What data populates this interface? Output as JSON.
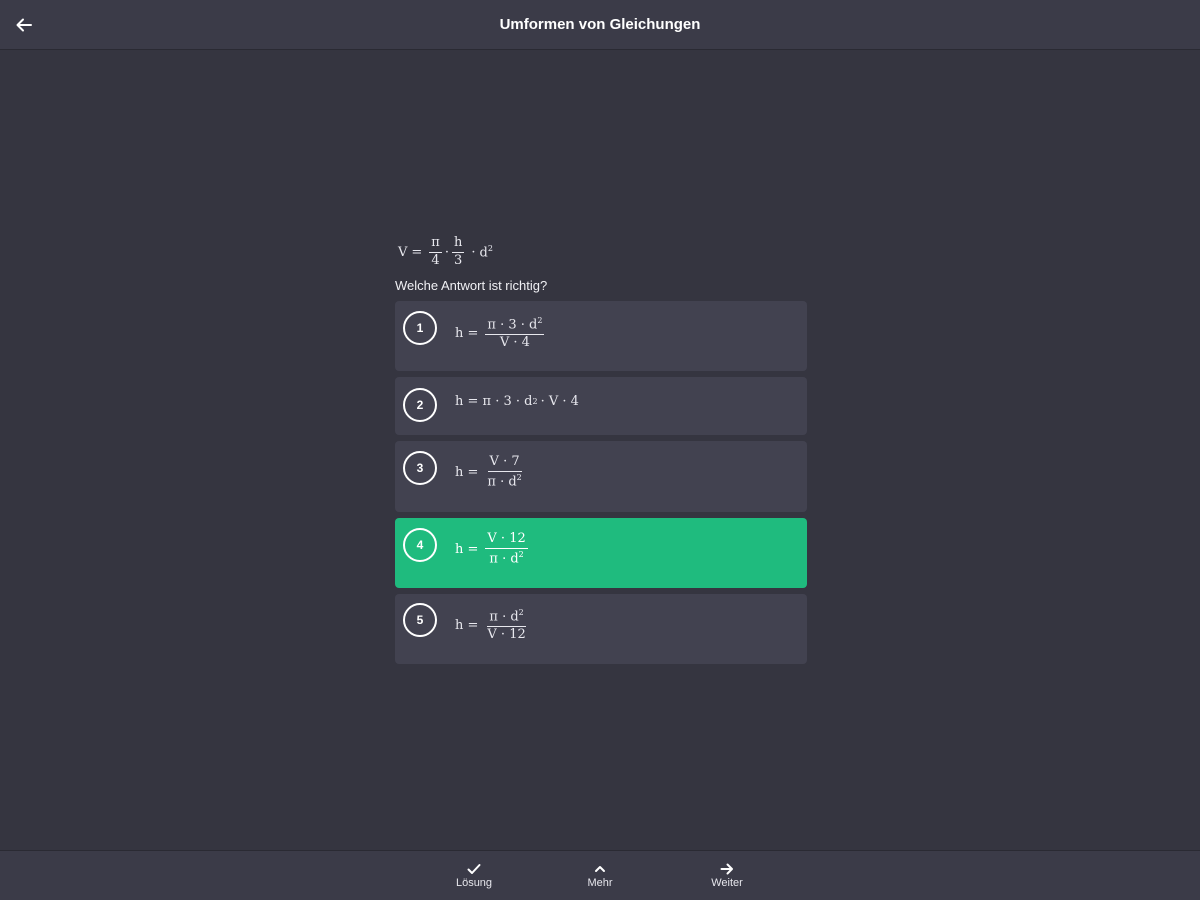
{
  "header": {
    "title": "Umformen von Gleichungen",
    "back_icon": "arrow-left-icon"
  },
  "question": {
    "formula": {
      "lhs": "V",
      "eq": "=",
      "f1_num": "π",
      "f1_den": "4",
      "dot1": "·",
      "f2_num": "h",
      "f2_den": "3",
      "dot2": "·",
      "d": "d",
      "d_exp": "2"
    },
    "prompt": "Welche Antwort ist richtig?"
  },
  "options": [
    {
      "number": "1",
      "lhs": "h =",
      "num": "π · 3 · d",
      "num_exp": "2",
      "den": "V · 4",
      "selected": false
    },
    {
      "number": "2",
      "text": "h = π · 3 · d",
      "exp": "2",
      "text_after": "· V · 4",
      "selected": false
    },
    {
      "number": "3",
      "lhs": "h =",
      "num": "V · 7",
      "den": "π · d",
      "den_exp": "2",
      "selected": false
    },
    {
      "number": "4",
      "lhs": "h =",
      "num": "V · 12",
      "den": "π · d",
      "den_exp": "2",
      "selected": true
    },
    {
      "number": "5",
      "lhs": "h =",
      "num": "π · d",
      "num_exp": "2",
      "den": "V · 12",
      "selected": false
    }
  ],
  "toolbar": {
    "solution_label": "Lösung",
    "solution_icon": "checkmark-icon",
    "more_label": "Mehr",
    "more_icon": "chevron-up-icon",
    "next_label": "Weiter",
    "next_icon": "arrow-right-icon"
  },
  "colors": {
    "background": "#353540",
    "bar": "#3b3b48",
    "option": "#424250",
    "selected": "#1fbb7e"
  }
}
